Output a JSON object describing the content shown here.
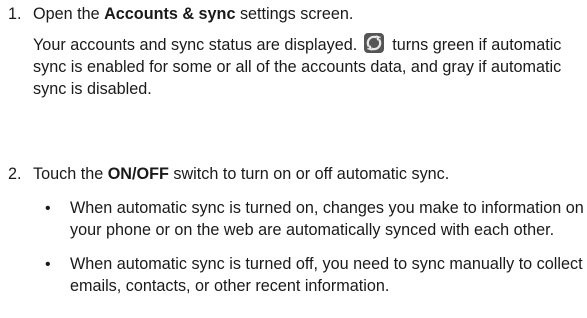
{
  "steps": [
    {
      "number": "1.",
      "text_before": "Open the ",
      "bold": "Accounts & sync",
      "text_after": " settings screen.",
      "description_before": "Your accounts and sync status are displayed. ",
      "description_icon": "sync-icon",
      "description_after": " turns green if automatic sync is enabled for some or all of the accounts data, and gray if automatic sync is disabled."
    },
    {
      "number": "2.",
      "text_before": "Touch the ",
      "bold": "ON/OFF",
      "text_after": " switch to turn on or off automatic sync.",
      "bullets": [
        "When automatic sync is turned on, changes you make to information on your phone or on the web are automatically synced with each other.",
        "When automatic sync is turned off, you need to sync manually to collect emails, contacts, or other recent information."
      ]
    }
  ],
  "bullet_glyph": "•",
  "colors": {
    "text": "#1a1a1a",
    "icon_bg": "#555555",
    "icon_fg": "#e0e0e0"
  }
}
